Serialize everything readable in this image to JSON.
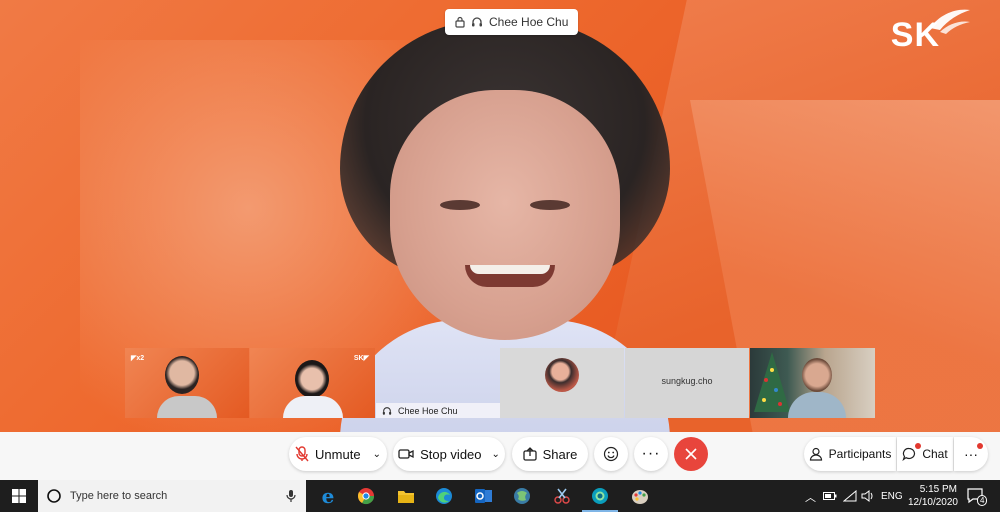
{
  "speaker": {
    "name": "Chee Hoe Chu"
  },
  "brand": {
    "logo_text": "SK"
  },
  "thumbnails": {
    "self_label": "Chee Hoe Chu",
    "participant_name": "sungkug.cho"
  },
  "controls": {
    "unmute_label": "Unmute",
    "stop_video_label": "Stop video",
    "share_label": "Share",
    "participants_label": "Participants",
    "chat_label": "Chat"
  },
  "taskbar": {
    "search_placeholder": "Type here to search",
    "language": "ENG",
    "time": "5:15 PM",
    "date": "12/10/2020",
    "notification_count": "4"
  },
  "colors": {
    "accent": "#ee6a2f",
    "end_call": "#e8453c"
  }
}
